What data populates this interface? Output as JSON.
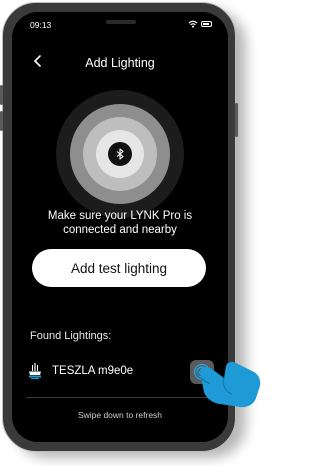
{
  "status_bar": {
    "time": "09:13",
    "icons": [
      "wifi-icon",
      "battery-icon"
    ]
  },
  "header": {
    "title": "Add Lighting",
    "back_icon": "chevron-left-icon"
  },
  "radar": {
    "center_icon": "bluetooth-icon",
    "colors": [
      "#1c1c1c",
      "#8e8e8e",
      "#bebebe",
      "#e6e6e6",
      "#111111"
    ]
  },
  "instruction": {
    "line1": "Make sure your LYNK Pro is",
    "line2": "connected and nearby"
  },
  "add_button": {
    "label": "Add test lighting"
  },
  "found": {
    "label": "Found Lightings:",
    "devices": [
      {
        "name": "TESZLA m9e0e",
        "icon": "lamp-icon",
        "action_icon": "fingerprint-icon"
      }
    ]
  },
  "refresh_hint": "Swipe down to refresh",
  "overlay": {
    "pointer_icon": "pointing-hand-icon",
    "accent": "#1e9ad6"
  }
}
